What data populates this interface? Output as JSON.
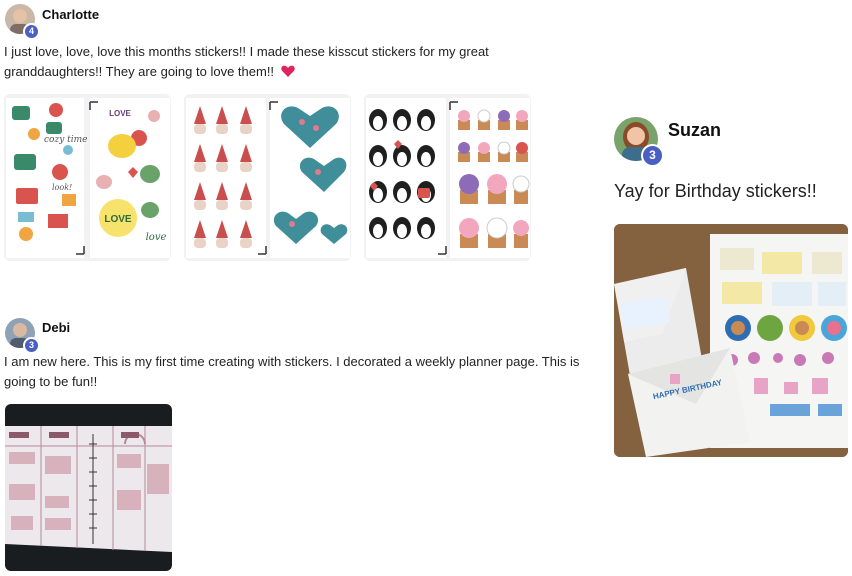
{
  "posts": [
    {
      "author": "Charlotte",
      "badge": "4",
      "text_line1": "I just love, love, love this months stickers!! I made these kisscut stickers for my great",
      "text_line2": "granddaughters!! They are going to love them!!",
      "emoji": "heart-icon",
      "photo_text": {
        "love": "LOVE",
        "love_script": "love",
        "love_you": "LOVE"
      }
    },
    {
      "author": "Debi",
      "badge": "3",
      "text_line1": "I am new here. This is my first time creating with stickers. I decorated a weekly planner page. This is",
      "text_line2": "going to be fun!!"
    },
    {
      "author": "Suzan",
      "badge": "3",
      "text": "Yay for Birthday stickers!!",
      "photo_text": {
        "happy_birthday": "HAPPY BIRTHDAY"
      }
    }
  ],
  "colors": {
    "badge": "#4a5fc1",
    "heart": "#e0245e",
    "card_bg": "#f2f2f4"
  }
}
